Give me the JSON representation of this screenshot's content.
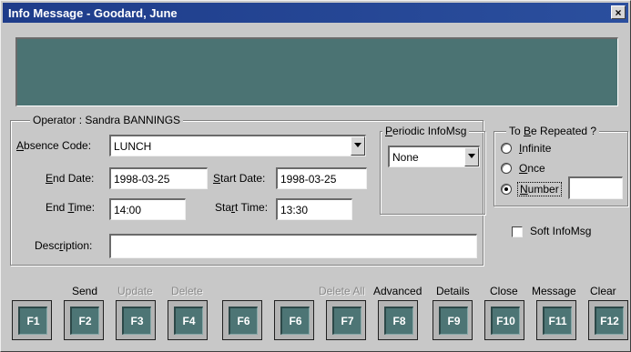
{
  "window": {
    "title": "Info Message - Goodard, June",
    "close_glyph": "×"
  },
  "operator": {
    "group_title": "Operator : Sandra BANNINGS",
    "absence_code_label": "Absence Code:",
    "absence_code_value": "LUNCH",
    "end_date_label": "End Date:",
    "end_date_value": "1998-03-25",
    "start_date_label": "Start Date:",
    "start_date_value": "1998-03-25",
    "end_time_label": "End Time:",
    "end_time_value": "14:00",
    "start_time_label": "Start Time:",
    "start_time_value": "13:30",
    "description_label": "Description:",
    "description_value": ""
  },
  "periodic": {
    "group_title": "Periodic InfoMsg",
    "selected": "None"
  },
  "repeat": {
    "group_title": "To Be Repeated ?",
    "options": [
      {
        "label": "Infinite",
        "checked": false
      },
      {
        "label": "Once",
        "checked": false
      },
      {
        "label": "Number",
        "checked": true
      }
    ],
    "number_value": ""
  },
  "soft_infomsg": {
    "label": "Soft InfoMsg",
    "checked": false
  },
  "fkeys": [
    {
      "key": "F1",
      "label": "",
      "disabled": false
    },
    {
      "key": "F2",
      "label": "Send",
      "disabled": false
    },
    {
      "key": "F3",
      "label": "Update",
      "disabled": true
    },
    {
      "key": "F4",
      "label": "Delete",
      "disabled": true
    },
    {
      "key": "F6",
      "label": "",
      "disabled": false
    },
    {
      "key": "F6",
      "label": "",
      "disabled": false
    },
    {
      "key": "F7",
      "label": "Delete All",
      "disabled": true
    },
    {
      "key": "F8",
      "label": "Advanced",
      "disabled": false
    },
    {
      "key": "F9",
      "label": "Details",
      "disabled": false
    },
    {
      "key": "F10",
      "label": "Close",
      "disabled": false
    },
    {
      "key": "F11",
      "label": "Message",
      "disabled": false
    },
    {
      "key": "F12",
      "label": "Clear",
      "disabled": false
    }
  ],
  "colors": {
    "title_bar": "#1e3c8a",
    "message_area": "#4b7373",
    "fkey_face": "#4d7575",
    "window_bg": "#c8c8c8"
  }
}
